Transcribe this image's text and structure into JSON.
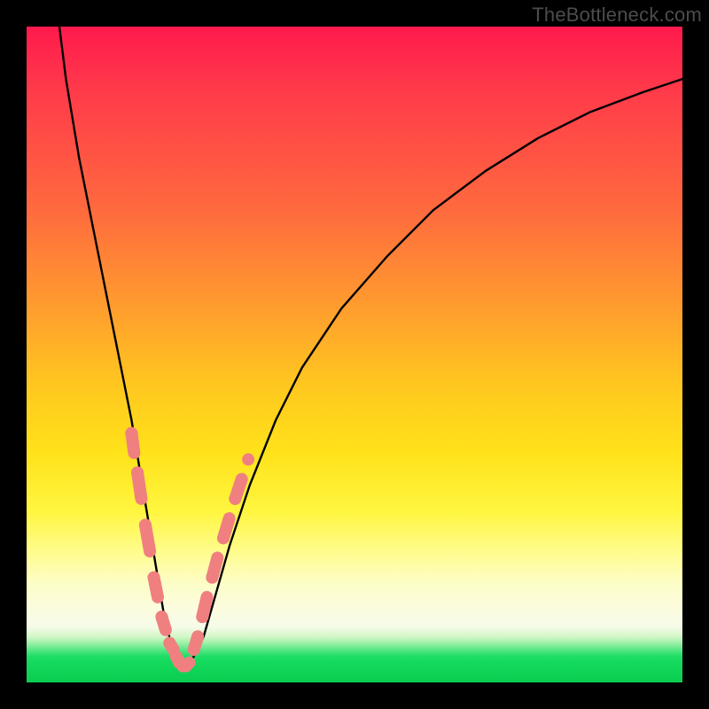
{
  "watermark": "TheBottleneck.com",
  "chart_data": {
    "type": "line",
    "title": "",
    "xlabel": "",
    "ylabel": "",
    "xlim": [
      0,
      100
    ],
    "ylim": [
      0,
      100
    ],
    "grid": false,
    "legend": false,
    "background_gradient": {
      "direction": "vertical",
      "stops": [
        {
          "pos": 0.0,
          "color": "#ff1a4d"
        },
        {
          "pos": 0.28,
          "color": "#ff6a3e"
        },
        {
          "pos": 0.55,
          "color": "#ffc81f"
        },
        {
          "pos": 0.74,
          "color": "#fff640"
        },
        {
          "pos": 0.89,
          "color": "#fbfce0"
        },
        {
          "pos": 0.95,
          "color": "#4de57f"
        },
        {
          "pos": 1.0,
          "color": "#0acd4f"
        }
      ]
    },
    "series": [
      {
        "name": "bottleneck-curve",
        "stroke": "#000000",
        "x": [
          5,
          6,
          8,
          10,
          12,
          14,
          16,
          17,
          18,
          19,
          20,
          21,
          22,
          23,
          24,
          25,
          27,
          29,
          31,
          34,
          38,
          42,
          48,
          55,
          62,
          70,
          78,
          86,
          94,
          100
        ],
        "y": [
          100,
          92,
          80,
          70,
          60,
          50,
          40,
          34,
          28,
          22,
          16,
          10,
          6,
          3,
          2,
          3,
          7,
          14,
          21,
          30,
          40,
          48,
          57,
          65,
          72,
          78,
          83,
          87,
          90,
          92
        ]
      }
    ],
    "markers": [
      {
        "name": "pink-segments-left",
        "color": "#f08080",
        "points": [
          {
            "x": 16.0,
            "y": 38
          },
          {
            "x": 16.4,
            "y": 35
          },
          {
            "x": 16.9,
            "y": 32
          },
          {
            "x": 17.5,
            "y": 28
          },
          {
            "x": 18.1,
            "y": 24
          },
          {
            "x": 18.8,
            "y": 20
          },
          {
            "x": 19.4,
            "y": 16
          },
          {
            "x": 20.0,
            "y": 13
          },
          {
            "x": 20.6,
            "y": 10
          },
          {
            "x": 21.2,
            "y": 8
          },
          {
            "x": 21.8,
            "y": 6
          },
          {
            "x": 22.4,
            "y": 5
          }
        ]
      },
      {
        "name": "pink-segments-bottom",
        "color": "#f08080",
        "points": [
          {
            "x": 22.8,
            "y": 4
          },
          {
            "x": 23.3,
            "y": 3
          },
          {
            "x": 23.8,
            "y": 2.5
          },
          {
            "x": 24.3,
            "y": 2.5
          },
          {
            "x": 24.8,
            "y": 3
          }
        ]
      },
      {
        "name": "pink-segments-right",
        "color": "#f08080",
        "points": [
          {
            "x": 25.5,
            "y": 5
          },
          {
            "x": 26.1,
            "y": 7
          },
          {
            "x": 26.8,
            "y": 10
          },
          {
            "x": 27.5,
            "y": 13
          },
          {
            "x": 28.3,
            "y": 16
          },
          {
            "x": 29.1,
            "y": 19
          },
          {
            "x": 30.0,
            "y": 22
          },
          {
            "x": 30.9,
            "y": 25
          },
          {
            "x": 31.8,
            "y": 28
          },
          {
            "x": 32.8,
            "y": 31
          },
          {
            "x": 33.8,
            "y": 34
          }
        ]
      }
    ]
  }
}
